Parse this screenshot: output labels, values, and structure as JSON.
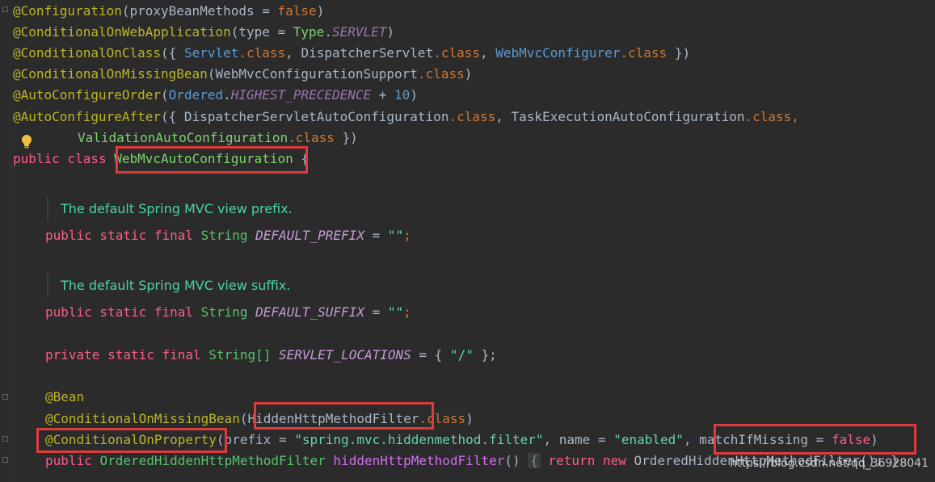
{
  "editor": {
    "lines": {
      "l1": {
        "a": "@Configuration",
        "b": "(proxyBeanMethods = ",
        "c": "false",
        "d": ")"
      },
      "l2": {
        "a": "@ConditionalOnWebApplication",
        "b": "(type = ",
        "c": "Type",
        "d": ".",
        "e": "SERVLET",
        "f": ")"
      },
      "l3": {
        "a": "@ConditionalOnClass",
        "b": "({ ",
        "c": "Servlet",
        "d": ".class",
        "e": ", DispatcherServlet",
        "f": ".class",
        "g": ", ",
        "h": "WebMvcConfigurer",
        "i": ".class",
        "j": " })"
      },
      "l4": {
        "a": "@ConditionalOnMissingBean",
        "b": "(WebMvcConfigurationSupport",
        "c": ".class",
        "d": ")"
      },
      "l5": {
        "a": "@AutoConfigureOrder",
        "b": "(",
        "c": "Ordered",
        "d": ".",
        "e": "HIGHEST_PRECEDENCE",
        "f": " + ",
        "g": "10",
        "h": ")"
      },
      "l6": {
        "a": "@AutoConfigureAfter",
        "b": "({ DispatcherServletAutoConfiguration",
        "c": ".class",
        "d": ", TaskExecutionAutoConfiguration",
        "e": ".class",
        "f": ","
      },
      "l7": {
        "a": "ValidationAutoConfiguration",
        "b": ".class",
        "c": " })"
      },
      "l8": {
        "a": "public class ",
        "b": "WebMvcAutoConfiguration",
        "c": " {"
      },
      "doc1": "The default Spring MVC view prefix.",
      "l9": {
        "a": "public static final ",
        "b": "String ",
        "c": "DEFAULT_PREFIX",
        "d": " = ",
        "e": "\"\"",
        "f": ";"
      },
      "doc2": "The default Spring MVC view suffix.",
      "l10": {
        "a": "public static final ",
        "b": "String ",
        "c": "DEFAULT_SUFFIX",
        "d": " = ",
        "e": "\"\"",
        "f": ";"
      },
      "l11": {
        "a": "private static final ",
        "b": "String[] ",
        "c": "SERVLET_LOCATIONS",
        "d": " = { ",
        "e": "\"/\"",
        "f": " };"
      },
      "l12": {
        "a": "@Bean"
      },
      "l13": {
        "a": "@ConditionalOnMissingBean",
        "b": "(HiddenHttpMethodFilter",
        "c": ".class",
        "d": ")"
      },
      "l14": {
        "a": "@ConditionalOnProperty",
        "b": "(prefix = ",
        "c": "\"spring.mvc.hiddenmethod.filter\"",
        "d": ", name = ",
        "e": "\"enabled\"",
        "f": ", matchIfMissing = ",
        "g": "false",
        "h": ")"
      },
      "l15": {
        "a": "public ",
        "b": "OrderedHiddenHttpMethodFilter ",
        "c": "hiddenHttpMethodFilter",
        "d": "() ",
        "e": "{",
        "f": " return new ",
        "g": "OrderedHiddenHttpMethodFilter",
        "h": "(); }"
      }
    },
    "watermark": "https://blog.csdn.net/qq_36928041",
    "colors": {
      "background": "#2b2b2b",
      "highlight_box": "#e03b3b"
    }
  }
}
